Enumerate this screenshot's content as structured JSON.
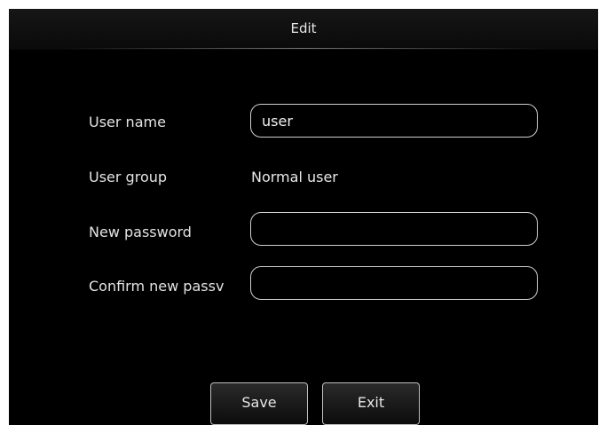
{
  "dialog": {
    "title": "Edit"
  },
  "form": {
    "user_name": {
      "label": "User name",
      "value": "user"
    },
    "user_group": {
      "label": "User group",
      "value": "Normal user"
    },
    "new_password": {
      "label": "New password",
      "value": ""
    },
    "confirm_password": {
      "label": "Confirm new passv",
      "value": ""
    }
  },
  "buttons": {
    "save": "Save",
    "exit": "Exit"
  }
}
